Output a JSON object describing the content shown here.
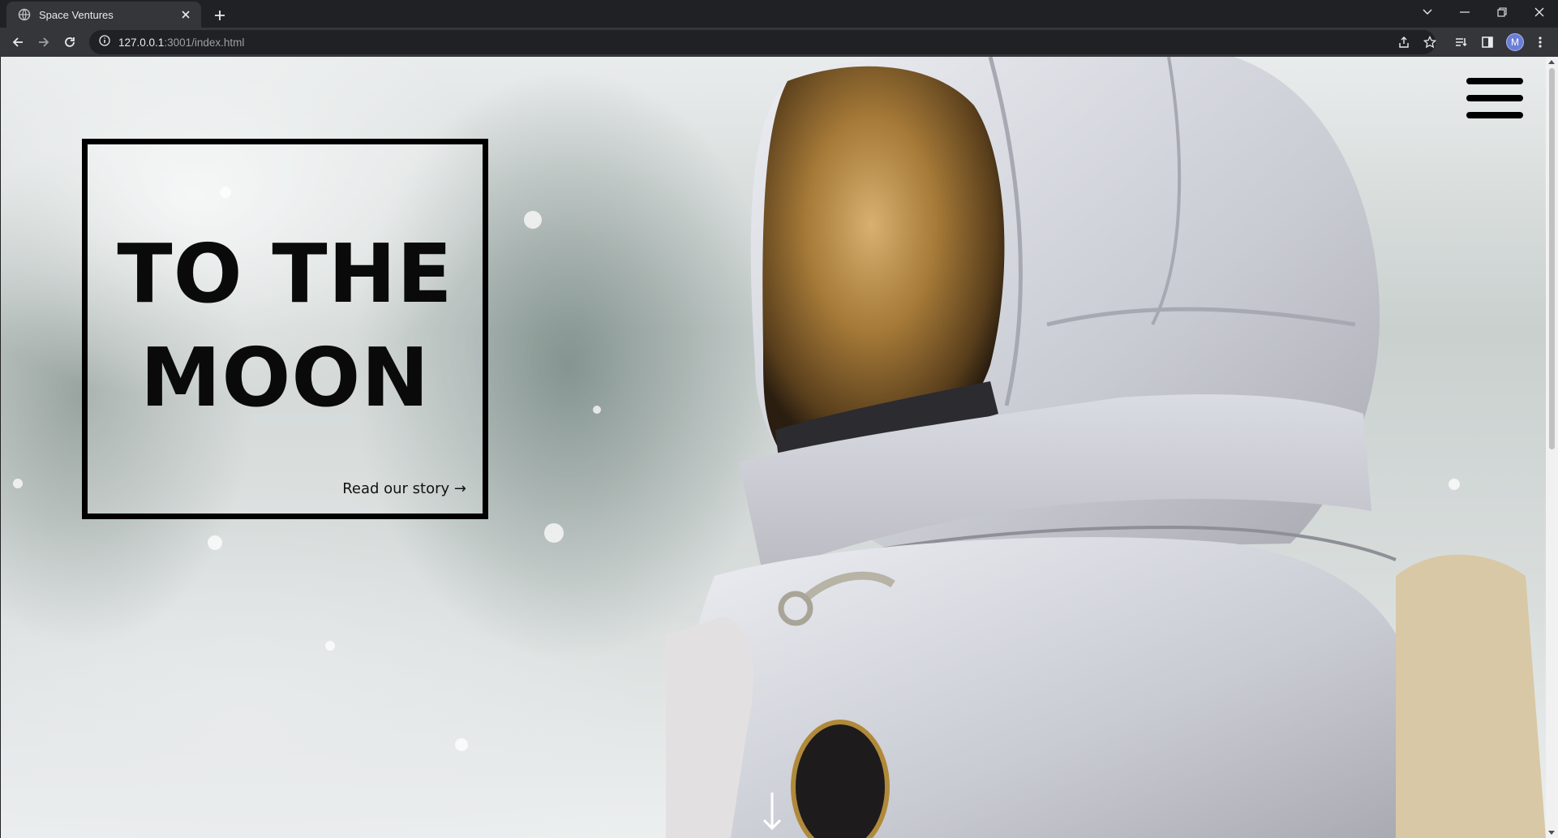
{
  "browser": {
    "tab_title": "Space Ventures",
    "url_host": "127.0.0.1",
    "url_rest": ":3001/index.html",
    "profile_initial": "M"
  },
  "hero": {
    "title_line1": "TO THE",
    "title_line2": "MOON",
    "link_text": "Read our story →"
  },
  "icons": {
    "menu": "hamburger-icon",
    "scroll": "arrow-down-icon"
  },
  "colors": {
    "chrome_bg": "#202124",
    "toolbar_bg": "#35363a",
    "text": "#0a0a0a"
  }
}
